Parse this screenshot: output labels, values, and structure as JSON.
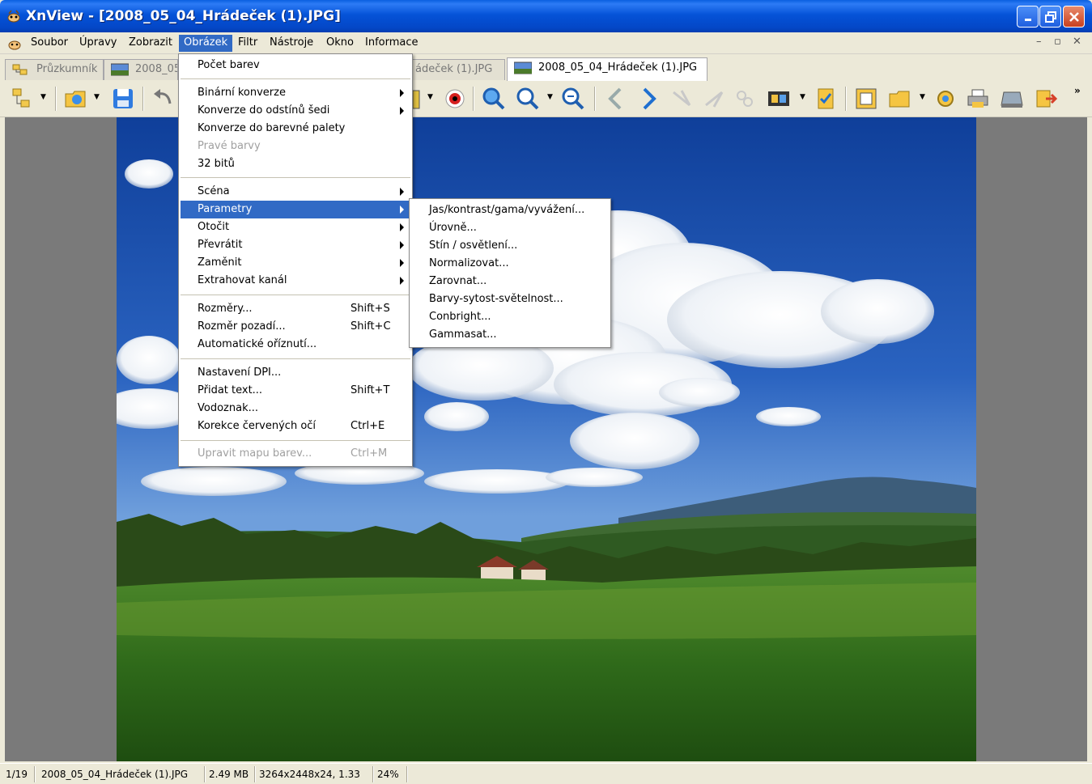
{
  "window": {
    "title": "XnView - [2008_05_04_Hrádeček (1).JPG]"
  },
  "menubar": {
    "items": [
      "Soubor",
      "Úpravy",
      "Zobrazit",
      "Obrázek",
      "Filtr",
      "Nástroje",
      "Okno",
      "Informace"
    ],
    "active": "Obrázek"
  },
  "tabs": [
    {
      "label": "Průzkumník",
      "active": false
    },
    {
      "label": "2008_05",
      "active": false
    },
    {
      "label": "ádeček (1).JPG",
      "active": false
    },
    {
      "label": "2008_05_04_Hrádeček (1).JPG",
      "active": true
    }
  ],
  "image_menu": {
    "items": [
      {
        "label": "Počet barev",
        "shortcut": "",
        "submenu": false,
        "disabled": false
      },
      {
        "label": "Binární konverze",
        "shortcut": "",
        "submenu": true,
        "disabled": false
      },
      {
        "label": "Konverze do odstínů šedi",
        "shortcut": "",
        "submenu": true,
        "disabled": false
      },
      {
        "label": "Konverze do barevné palety",
        "shortcut": "",
        "submenu": false,
        "disabled": false
      },
      {
        "label": "Pravé barvy",
        "shortcut": "",
        "submenu": false,
        "disabled": true
      },
      {
        "label": "32 bitů",
        "shortcut": "",
        "submenu": false,
        "disabled": false
      },
      {
        "label": "Scéna",
        "shortcut": "",
        "submenu": true,
        "disabled": false
      },
      {
        "label": "Parametry",
        "shortcut": "",
        "submenu": true,
        "disabled": false,
        "highlighted": true
      },
      {
        "label": "Otočit",
        "shortcut": "",
        "submenu": true,
        "disabled": false
      },
      {
        "label": "Převrátit",
        "shortcut": "",
        "submenu": true,
        "disabled": false
      },
      {
        "label": "Zaměnit",
        "shortcut": "",
        "submenu": true,
        "disabled": false
      },
      {
        "label": "Extrahovat kanál",
        "shortcut": "",
        "submenu": true,
        "disabled": false
      },
      {
        "label": "Rozměry...",
        "shortcut": "Shift+S",
        "submenu": false,
        "disabled": false
      },
      {
        "label": "Rozměr pozadí...",
        "shortcut": "Shift+C",
        "submenu": false,
        "disabled": false
      },
      {
        "label": "Automatické oříznutí...",
        "shortcut": "",
        "submenu": false,
        "disabled": false
      },
      {
        "label": "Nastavení DPI...",
        "shortcut": "",
        "submenu": false,
        "disabled": false
      },
      {
        "label": "Přidat text...",
        "shortcut": "Shift+T",
        "submenu": false,
        "disabled": false
      },
      {
        "label": "Vodoznak...",
        "shortcut": "",
        "submenu": false,
        "disabled": false
      },
      {
        "label": "Korekce červených očí",
        "shortcut": "Ctrl+E",
        "submenu": false,
        "disabled": false
      },
      {
        "label": "Upravit mapu barev...",
        "shortcut": "Ctrl+M",
        "submenu": false,
        "disabled": true
      }
    ]
  },
  "parametry_submenu": {
    "items": [
      "Jas/kontrast/gama/vyvážení...",
      "Úrovně...",
      "Stín / osvětlení...",
      "Normalizovat...",
      "Zarovnat...",
      "Barvy-sytost-světelnost...",
      "Conbright...",
      "Gammasat..."
    ]
  },
  "statusbar": {
    "index": "1/19",
    "filename": "2008_05_04_Hrádeček (1).JPG",
    "filesize": "2.49 MB",
    "dimensions": "3264x2448x24, 1.33",
    "zoom": "24%"
  },
  "icons": {
    "toolbar": [
      "browser-icon",
      "open-folder-icon",
      "save-icon",
      "undo-icon",
      "color-icon",
      "red-eye-icon",
      "zoom-icon",
      "zoom-in-icon",
      "zoom-out-icon",
      "previous-icon",
      "next-icon",
      "first-icon",
      "last-icon",
      "slideshow-icon",
      "filmstrip-icon",
      "edit-icon",
      "fullscreen-icon",
      "open-icon",
      "settings-icon",
      "print-icon",
      "scan-icon",
      "export-icon"
    ]
  },
  "colors": {
    "title_bar": "#0553d8",
    "menu_highlight": "#316ac5"
  }
}
